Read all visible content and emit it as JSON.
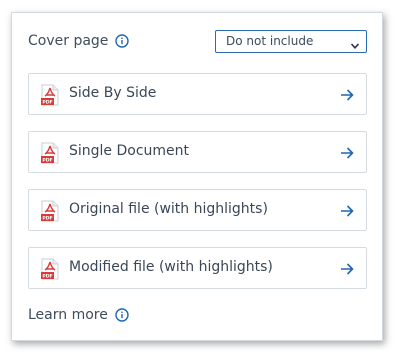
{
  "cover_page": {
    "label": "Cover page",
    "info_icon": "info-icon",
    "select_value": "Do not include"
  },
  "options": [
    {
      "label": "Side By Side",
      "icon": "pdf-file-icon"
    },
    {
      "label": "Single Document",
      "icon": "pdf-file-icon"
    },
    {
      "label": "Original file (with highlights)",
      "icon": "pdf-file-icon"
    },
    {
      "label": "Modified file (with highlights)",
      "icon": "pdf-file-icon"
    }
  ],
  "learn_more": {
    "label": "Learn more",
    "icon": "info-icon"
  },
  "colors": {
    "accent": "#1e66b4",
    "pdf_red": "#d93a3a",
    "text": "#3c4a5a",
    "border": "#d6dbe0"
  }
}
